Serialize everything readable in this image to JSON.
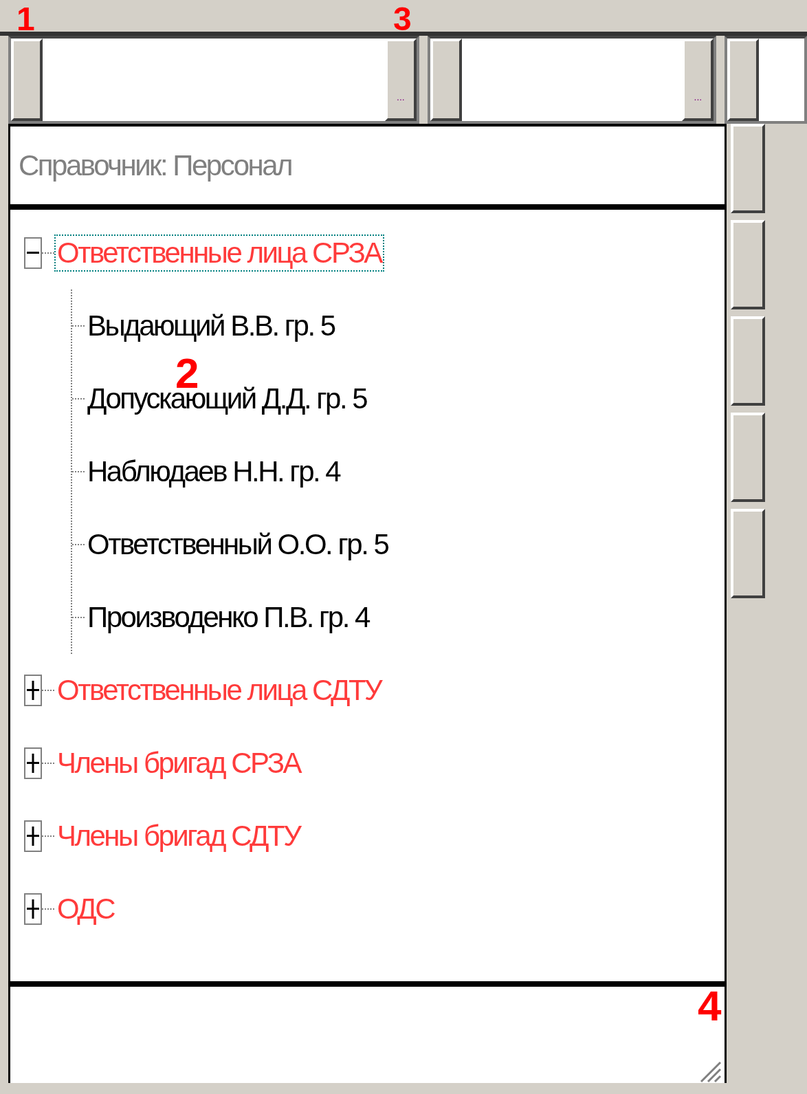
{
  "fields": [
    {
      "kind": "browse",
      "button_label": "..."
    },
    {
      "kind": "browse",
      "button_label": "..."
    },
    {
      "kind": "plain"
    }
  ],
  "lookup": {
    "title": "Справочник: Персонал"
  },
  "tree": [
    {
      "label": "Ответственные лица СРЗА",
      "kind": "group",
      "expanded": true,
      "selected": true,
      "children": [
        {
          "label": "Выдающий В.В. гр. 5",
          "kind": "person",
          "selected": false
        },
        {
          "label": "Допускающий Д.Д. гр. 5",
          "kind": "person",
          "selected": false
        },
        {
          "label": "Наблюдаев Н.Н. гр. 4",
          "kind": "person",
          "selected": false
        },
        {
          "label": "Ответственный О.О. гр. 5",
          "kind": "person",
          "selected": false
        },
        {
          "label": "Производенко П.В. гр. 4",
          "kind": "person",
          "selected": false
        }
      ]
    },
    {
      "label": "Ответственные лица СДТУ",
      "kind": "group",
      "expanded": false,
      "selected": false
    },
    {
      "label": "Члены бригад СРЗА",
      "kind": "group",
      "expanded": false,
      "selected": false
    },
    {
      "label": "Члены бригад СДТУ",
      "kind": "group",
      "expanded": false,
      "selected": false
    },
    {
      "label": "ОДС",
      "kind": "group",
      "expanded": false,
      "selected": false
    }
  ],
  "annotations": [
    {
      "label": "1"
    },
    {
      "label": "2"
    },
    {
      "label": "3"
    },
    {
      "label": "4"
    }
  ]
}
